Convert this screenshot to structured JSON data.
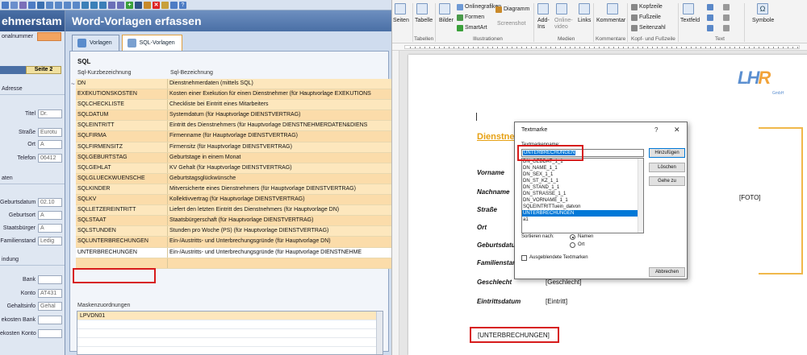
{
  "left_app": {
    "bg_form": {
      "title": "ehmerstam",
      "section_top": "onalnummer",
      "tab": "Seite 2",
      "sec_adresse": "Adresse",
      "sec_daten": "aten",
      "sec_bindung": "indung",
      "fields": [
        {
          "label": "Titel",
          "value": "Dr."
        },
        {
          "label": "Straße",
          "value": "Eurotu"
        },
        {
          "label": "Ort",
          "value": "A"
        },
        {
          "label": "Telefon",
          "value": "06412"
        },
        {
          "label": "Geburtsdatum",
          "value": "02.10"
        },
        {
          "label": "Geburtsort",
          "value": "A"
        },
        {
          "label": "Staatsbürger",
          "value": "A"
        },
        {
          "label": "Familienstand",
          "value": "Ledig"
        },
        {
          "label": "Bank",
          "value": ""
        },
        {
          "label": "Konto",
          "value": "AT431"
        },
        {
          "label": "Gehaltsinfo",
          "value": "Gehal"
        },
        {
          "label": "ekosten Bank",
          "value": ""
        },
        {
          "label": "ekosten Konto",
          "value": ""
        }
      ]
    },
    "dialog": {
      "title": "Word-Vorlagen erfassen",
      "tabs": [
        "Vorlagen",
        "SQL-Vorlagen"
      ],
      "section": "SQL",
      "col1": "Sql-Kurzbezeichnung",
      "col2": "Sql-Bezeichnung",
      "rows": [
        {
          "k": "DN",
          "v": "Dienstnehmerdaten (mittels SQL)"
        },
        {
          "k": "EXEKUTIONSKOSTEN",
          "v": "Kosten einer Exekution für einen Dienstnehmer (für Hauptvorlage EXEKUTIONS"
        },
        {
          "k": "SQLCHECKLISTE",
          "v": "Checkliste bei Eintritt eines Mitarbeiters"
        },
        {
          "k": "SQLDATUM",
          "v": "Systemdatum (für Hauptvorlage DIENSTVERTRAG)"
        },
        {
          "k": "SQLEINTRITT",
          "v": "Eintritt des Dienstnehmers (für Hauptvorlage DIENSTNEHMERDATEN&DIENS"
        },
        {
          "k": "SQLFIRMA",
          "v": "Firmenname (für Hauptvorlage DIENSTVERTRAG)"
        },
        {
          "k": "SQLFIRMENSITZ",
          "v": "Firmensitz (für Hauptvorlage DIENSTVERTRAG)"
        },
        {
          "k": "SQLGEBURTSTAG",
          "v": "Geburtstage in einem Monat"
        },
        {
          "k": "SQLGEHLAT",
          "v": "KV Gehalt (für Hauptvorlage DIENSTVERTRAG)"
        },
        {
          "k": "SQLGLUECKWUENSCHE",
          "v": "Geburtstagsglückwünsche"
        },
        {
          "k": "SQLKINDER",
          "v": "Mitversicherte eines Dienstnehmers (für Hauptvorlage DIENSTVERTRAG)"
        },
        {
          "k": "SQLKV",
          "v": "Kollektivvertrag (für Hauptvorlage DIENSTVERTRAG)"
        },
        {
          "k": "SQLLETZEREINTRITT",
          "v": "Liefert den letzten Eintritt des Dienstnehmers (für Hauptvorlage DN)"
        },
        {
          "k": "SQLSTAAT",
          "v": "Staatsbürgerschaft (für Hauptvorlage DIENSTVERTRAG)"
        },
        {
          "k": "SQLSTUNDEN",
          "v": "Stunden pro Woche (PS) (für Hauptvorlage DIENSTVERTRAG)"
        },
        {
          "k": "SQLUNTERBRECHUNGEN",
          "v": "Ein-/Austritts- und Unterbrechungsgründe (für Hauptvorlage DN)"
        },
        {
          "k": "UNTERBRECHUNGEN",
          "v": "Ein-/Austritts- und Unterbrechungsgründe (für Hauptvorlage DIENSTNEHME"
        },
        {
          "k": "",
          "v": ""
        }
      ],
      "mask_label": "Maskenzuordnungen",
      "mask_items": [
        "LPVDN01",
        "",
        "",
        ""
      ]
    }
  },
  "word": {
    "ribbon": {
      "buttons": [
        "Seiten",
        "Tabelle",
        "Bilder",
        "Onlinegrafiken",
        "Formen",
        "SmartArt",
        "Diagramm",
        "Screenshot",
        "Add-Ins",
        "Online-video",
        "Links",
        "Kommentar",
        "Kopfzeile",
        "Fußzeile",
        "Seitenzahl",
        "Textfeld",
        "Symbole"
      ],
      "groups": [
        "Tabellen",
        "Illustrationen",
        "Medien",
        "Kommentare",
        "Kopf- und Fußzeile",
        "Text"
      ]
    },
    "doc": {
      "title": "Dienstnehm",
      "labels": [
        "Vorname",
        "Nachname",
        "Straße",
        "Ort",
        "Geburtsdatum",
        "Familienstand",
        "Geschlecht",
        "Eintrittsdatum"
      ],
      "values": {
        "geschlecht": "[Geschlecht]",
        "eintritt": "[Eintritt]",
        "foto": "[FOTO]"
      },
      "bookmark_field": "[UNTERBRECHUNGEN]",
      "logo_main": "LH",
      "logo_r": "R",
      "logo_sub": "GmbH"
    },
    "textmarke": {
      "title": "Textmarke",
      "help": "?",
      "close": "✕",
      "name_label": "Textmarkenname:",
      "name_value": "UNTERBRECHUNGEN",
      "items": [
        "DN_GEBDAT_1_1",
        "DN_NAME_1_1",
        "DN_SEX_1_1",
        "DN_ST_KZ_1_1",
        "DN_STAND_1_1",
        "DN_STRASSE_1_1",
        "DN_VORNAME_1_1",
        "SQLEINTRITTuein_datvon",
        "UNTERBRECHUNGEN",
        "a1"
      ],
      "selected_index": 8,
      "btn_add": "Hinzufügen",
      "btn_delete": "Löschen",
      "btn_goto": "Gehe zu",
      "btn_cancel": "Abbrechen",
      "sort_label": "Sortieren nach:",
      "sort_name": "Namen",
      "sort_pos": "Ort",
      "hidden_label": "Ausgeblendete Textmarken"
    }
  },
  "colors": {
    "accent_red": "#d71b1b",
    "row_odd": "#fde7bd",
    "row_even": "#fbdcaa",
    "word_blue": "#0078d7",
    "title_orange": "#e6a012"
  }
}
